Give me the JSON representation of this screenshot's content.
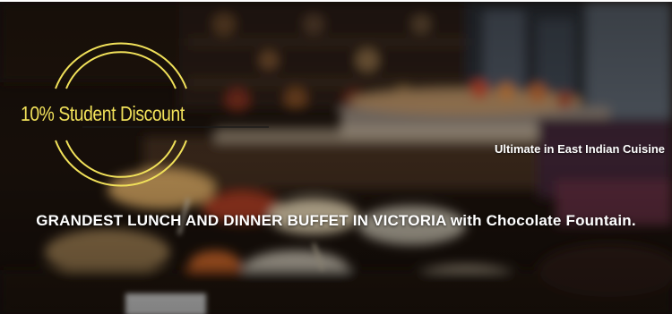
{
  "banner": {
    "badge_text": "10% Student Discount",
    "tagline": "Ultimate in East Indian Cuisine",
    "headline": "GRANDEST LUNCH AND DINNER BUFFET IN VICTORIA with Chocolate Fountain."
  },
  "colors": {
    "badge_yellow": "#f1e15a",
    "text_white": "#ffffff",
    "background_dark": "#120c08"
  }
}
